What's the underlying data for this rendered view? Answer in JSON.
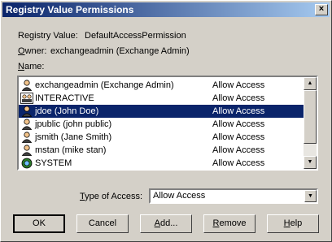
{
  "window": {
    "title": "Registry Value Permissions",
    "close_glyph": "×"
  },
  "registry_value": {
    "label": "Registry Value:",
    "value": "DefaultAccessPermission"
  },
  "owner": {
    "label_first": "O",
    "label_rest": "wner:",
    "value": "exchangeadmin (Exchange Admin)"
  },
  "name_label": {
    "first": "N",
    "rest": "ame:"
  },
  "list": {
    "rows": [
      {
        "name": "exchangeadmin (Exchange Admin)",
        "access": "Allow Access",
        "icon": "user-icon",
        "selected": false
      },
      {
        "name": "INTERACTIVE",
        "access": "Allow Access",
        "icon": "group-icon",
        "selected": false
      },
      {
        "name": "jdoe (John Doe)",
        "access": "Allow Access",
        "icon": "user-icon",
        "selected": true
      },
      {
        "name": "jpublic (john public)",
        "access": "Allow Access",
        "icon": "user-icon",
        "selected": false
      },
      {
        "name": "jsmith (Jane Smith)",
        "access": "Allow Access",
        "icon": "user-icon",
        "selected": false
      },
      {
        "name": "mstan (mike stan)",
        "access": "Allow Access",
        "icon": "user-icon",
        "selected": false
      },
      {
        "name": "SYSTEM",
        "access": "Allow Access",
        "icon": "system-icon",
        "selected": false
      }
    ],
    "scroll_up_glyph": "▲",
    "scroll_down_glyph": "▼"
  },
  "type_of_access": {
    "label_first": "T",
    "label_rest": "ype of Access:",
    "value": "Allow Access",
    "drop_glyph": "▼"
  },
  "buttons": {
    "ok": "OK",
    "cancel": "Cancel",
    "add_first": "A",
    "add_rest": "dd...",
    "remove_first": "R",
    "remove_rest": "emove",
    "help_first": "H",
    "help_rest": "elp"
  },
  "colors": {
    "selection": "#0a246a",
    "face": "#d4d0c8"
  }
}
